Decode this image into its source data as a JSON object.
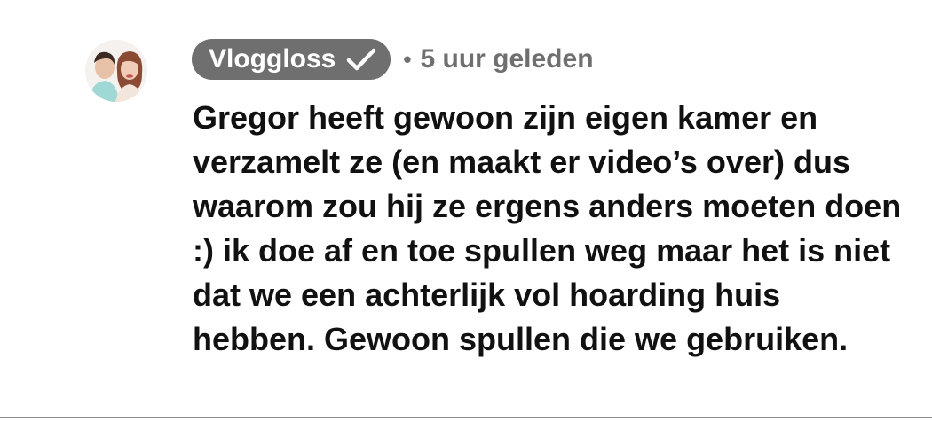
{
  "comment": {
    "author": "Vloggloss",
    "verified_icon": "checkmark-icon",
    "separator": "•",
    "timestamp": "5 uur geleden",
    "text": "Gregor heeft gewoon zijn eigen kamer en verzamelt ze (en maakt er video’s over) dus waarom zou hij ze ergens anders moeten doen :) ik doe af en toe spullen weg maar het is niet dat we een achterlijk vol hoarding huis hebben. Gewoon spullen die we gebruiken."
  },
  "colors": {
    "badge_bg": "#6f6f6f",
    "badge_text": "#ffffff",
    "meta_text": "#6f6f6f",
    "body_text": "#111111",
    "background": "#ffffff"
  }
}
